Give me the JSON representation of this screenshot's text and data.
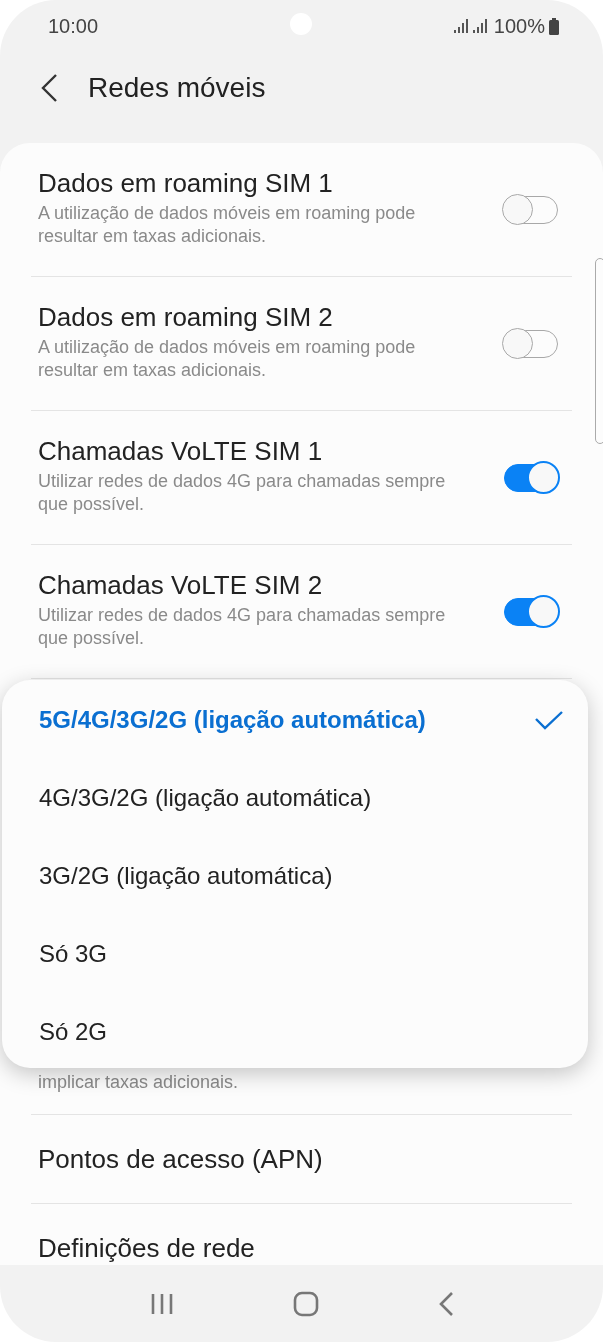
{
  "status_bar": {
    "time": "10:00",
    "battery": "100%"
  },
  "header": {
    "title": "Redes móveis"
  },
  "settings": [
    {
      "title": "Dados em roaming SIM 1",
      "subtitle": "A utilização de dados móveis em roaming pode resultar em taxas adicionais.",
      "on": false
    },
    {
      "title": "Dados em roaming SIM 2",
      "subtitle": "A utilização de dados móveis em roaming pode resultar em taxas adicionais.",
      "on": false
    },
    {
      "title": "Chamadas VoLTE SIM 1",
      "subtitle": "Utilizar redes de dados 4G para chamadas sempre que possível.",
      "on": true
    },
    {
      "title": "Chamadas VoLTE SIM 2",
      "subtitle": "Utilizar redes de dados 4G para chamadas sempre que possível.",
      "on": true
    }
  ],
  "covered_subtitle": "implicar taxas adicionais.",
  "links": [
    "Pontos de acesso (APN)",
    "Definições de rede"
  ],
  "network_mode_menu": [
    {
      "label": "5G/4G/3G/2G (ligação automática)",
      "selected": true
    },
    {
      "label": "4G/3G/2G (ligação automática)",
      "selected": false
    },
    {
      "label": "3G/2G (ligação automática)",
      "selected": false
    },
    {
      "label": "Só 3G",
      "selected": false
    },
    {
      "label": "Só 2G",
      "selected": false
    }
  ]
}
